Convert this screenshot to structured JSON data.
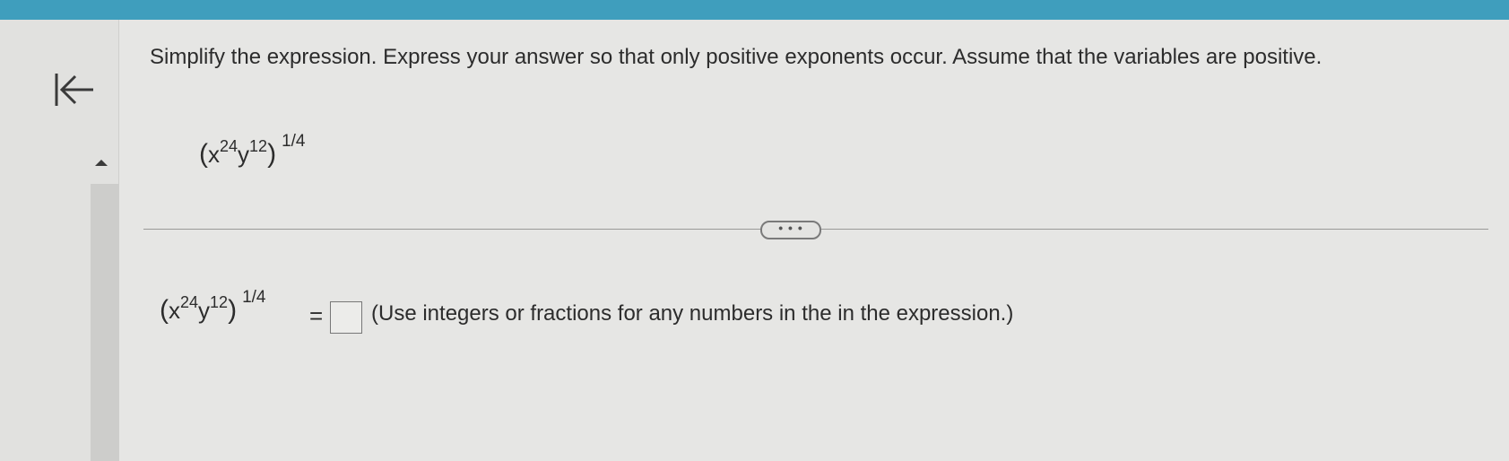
{
  "question": {
    "prompt": "Simplify the expression. Express your answer so that only positive exponents occur. Assume that the variables are positive."
  },
  "expression": {
    "base_x": "x",
    "exp_x": "24",
    "base_y": "y",
    "exp_y": "12",
    "open_paren": "(",
    "close_paren": ")",
    "outer_exponent": "1/4"
  },
  "answer": {
    "equals": "=",
    "box_value": "",
    "instruction": "(Use integers or fractions for any numbers in the in the expression.)"
  },
  "controls": {
    "more_label": "• • •"
  },
  "colors": {
    "topbar": "#3f9ebd",
    "background": "#e6e6e4"
  }
}
